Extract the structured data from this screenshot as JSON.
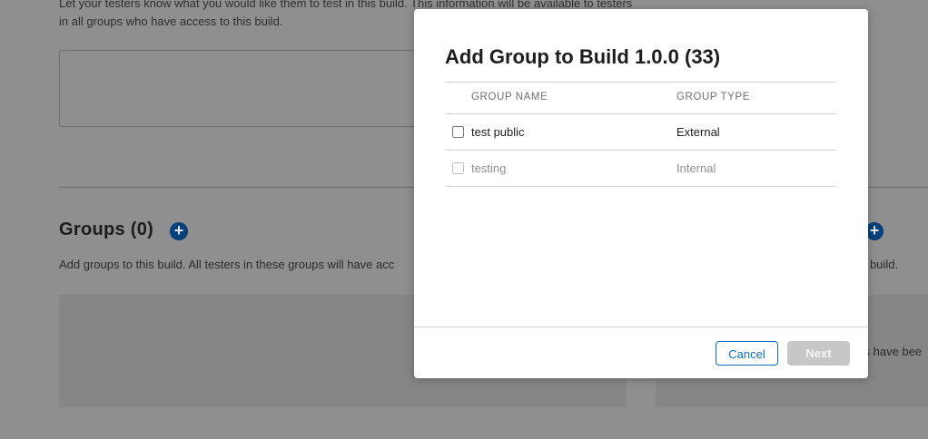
{
  "background": {
    "description": "Let your testers know what you would like them to test in this build. This information will be available to testers in all groups who have access to this build.",
    "groups_title": "Groups (0)",
    "add_icon_glyph": "+",
    "groups_description": "Add groups to this build. All testers in these groups will have acc",
    "right_description": "build.",
    "right_panel_text": "ers have bee"
  },
  "modal": {
    "title": "Add Group to Build 1.0.0 (33)",
    "columns": {
      "name": "GROUP NAME",
      "type": "GROUP TYPE"
    },
    "rows": [
      {
        "name": "test public",
        "type": "External",
        "enabled": true,
        "checked": false
      },
      {
        "name": "testing",
        "type": "Internal",
        "enabled": false,
        "checked": false
      }
    ],
    "buttons": {
      "cancel": "Cancel",
      "next": "Next"
    }
  },
  "colors": {
    "accent": "#0a6ac4",
    "disabled_button": "#c7c7c7",
    "overlay": "#8f8f8f"
  }
}
